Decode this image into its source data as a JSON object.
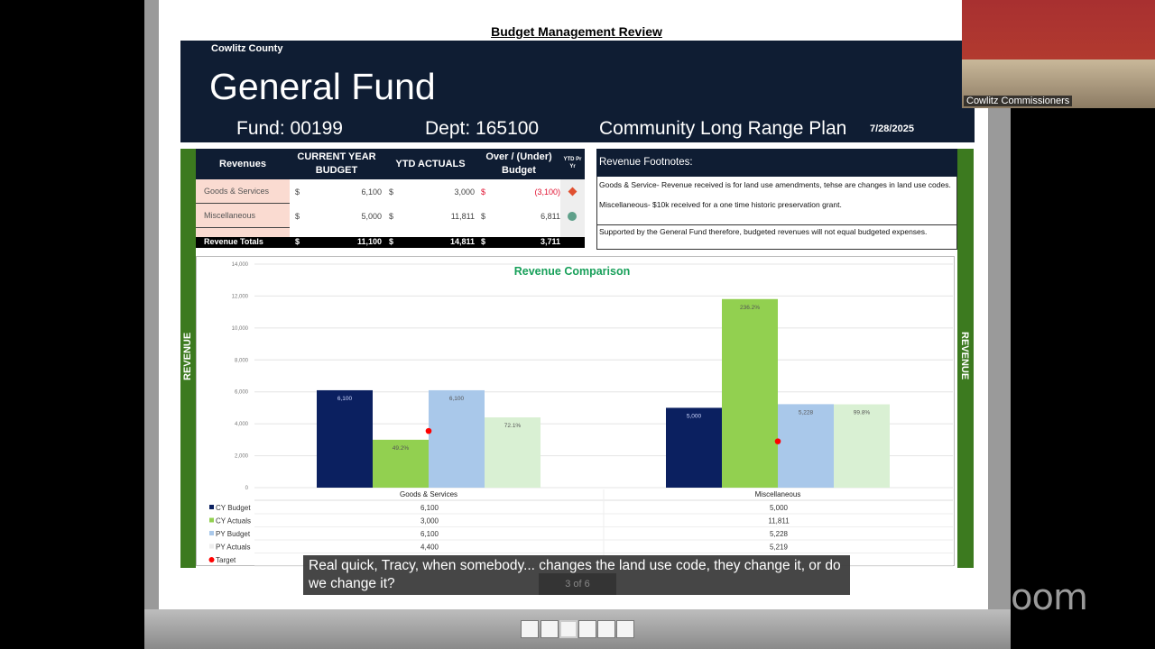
{
  "slide": {
    "title": "Budget Management Review",
    "county": "Cowlitz County",
    "fund_name": "General Fund",
    "fund": "Fund: 00199",
    "dept": "Dept: 165100",
    "division": "Community Long Range Plan",
    "date": "7/28/2025",
    "side_label": "REVENUE"
  },
  "revenue_table": {
    "headers": [
      "Revenues",
      "CURRENT YEAR BUDGET",
      "YTD ACTUALS",
      "Over / (Under) Budget",
      "YTD Pr Yr"
    ],
    "rows": [
      {
        "label": "Goods & Services",
        "budget": "6,100",
        "actuals": "3,000",
        "over": "(3,100)",
        "indicator": "red-diamond"
      },
      {
        "label": "Miscellaneous",
        "budget": "5,000",
        "actuals": "11,811",
        "over": "6,811",
        "indicator": "green-circle"
      }
    ],
    "totals": {
      "label": "Revenue Totals",
      "budget": "11,100",
      "actuals": "14,811",
      "over": "3,711"
    },
    "currency": "$"
  },
  "footnotes": {
    "title": "Revenue Footnotes:",
    "goods": "Goods & Service- Revenue received is for land use amendments, tehse are changes in land use codes.",
    "misc": "Miscellaneous- $10k received for a one time historic preservation grant.",
    "support": "Supported by the General Fund therefore, budgeted revenues will not equal budgeted expenses."
  },
  "chart_data": {
    "type": "bar",
    "title": "Revenue Comparison",
    "categories": [
      "Goods & Services",
      "Miscellaneous"
    ],
    "ylim": [
      0,
      14000
    ],
    "yticks": [
      "0",
      "2,000",
      "4,000",
      "6,000",
      "8,000",
      "10,000",
      "12,000",
      "14,000"
    ],
    "series": [
      {
        "name": "CY Budget",
        "color": "#0b2060",
        "values": [
          6100,
          5000
        ],
        "labels": [
          "6,100",
          "5,000"
        ],
        "display": [
          "6,100",
          "5,000"
        ]
      },
      {
        "name": "CY Actuals",
        "color": "#92d050",
        "values": [
          3000,
          11811
        ],
        "labels": [
          "49.2%",
          "236.2%"
        ],
        "display": [
          "3,000",
          "11,811"
        ]
      },
      {
        "name": "PY Budget",
        "color": "#a9c8ea",
        "values": [
          6100,
          5228
        ],
        "labels": [
          "6,100",
          "5,228"
        ],
        "display": [
          "6,100",
          "5,228"
        ]
      },
      {
        "name": "PY Actuals",
        "color": "#d9f0d3",
        "values": [
          4400,
          5219
        ],
        "labels": [
          "72.1%",
          "99.8%"
        ],
        "display": [
          "4,400",
          "5,219"
        ]
      }
    ],
    "target": {
      "name": "Target",
      "color": "#ff0000",
      "values": [
        3550,
        2900
      ]
    },
    "grid": true,
    "legend": "data-table-bottom"
  },
  "caption": "Real quick, Tracy, when somebody... changes the land use code, they change it, or do we change it?",
  "slide_counter": "3 of 6",
  "video": {
    "label": "Cowlitz Commissioners"
  },
  "brand": "zoom"
}
